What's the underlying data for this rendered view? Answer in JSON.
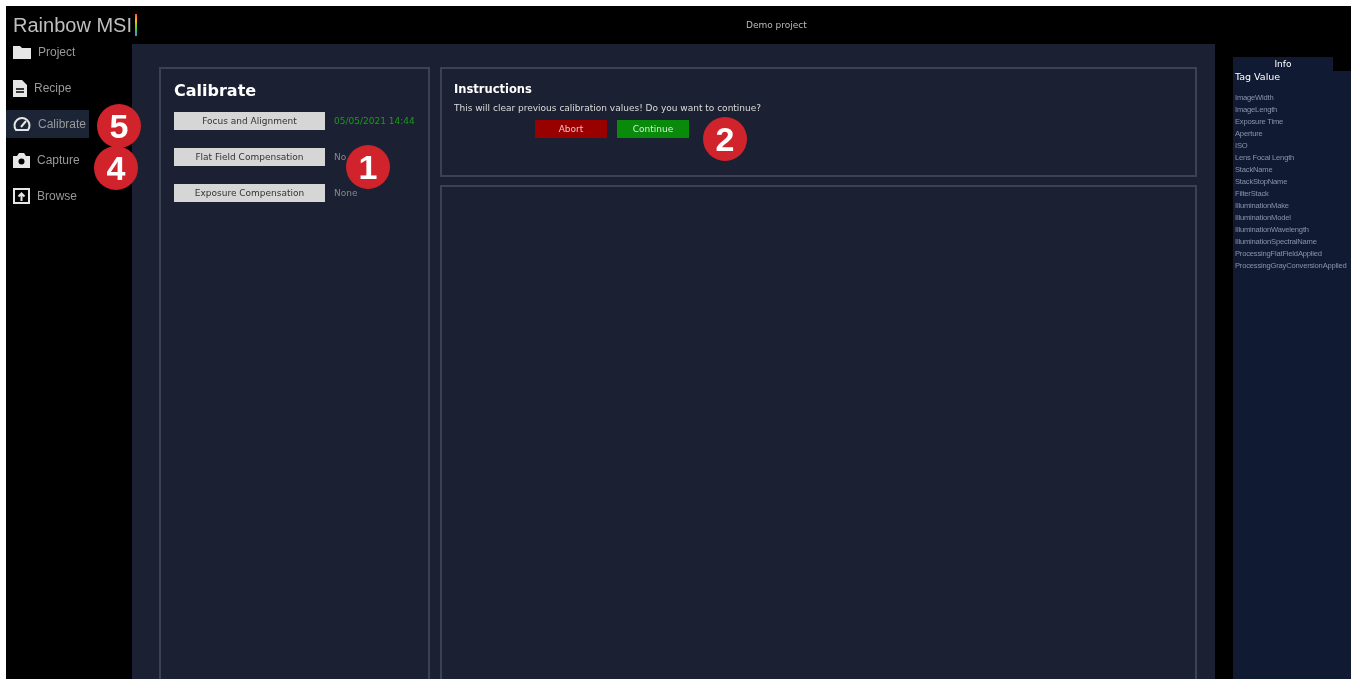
{
  "app_title": "Rainbow MSI",
  "project_title": "Demo project",
  "sidebar": {
    "items": [
      {
        "label": "Project",
        "selected": false
      },
      {
        "label": "Recipe",
        "selected": false
      },
      {
        "label": "Calibrate",
        "selected": true
      },
      {
        "label": "Capture",
        "selected": false
      },
      {
        "label": "Browse",
        "selected": false
      }
    ]
  },
  "calibrate": {
    "title": "Calibrate",
    "steps": [
      {
        "button": "Focus and Alignment",
        "status": "05/05/2021 14:44",
        "done": true
      },
      {
        "button": "Flat Field Compensation",
        "status": "No",
        "done": false
      },
      {
        "button": "Exposure Compensation",
        "status": "None",
        "done": false
      }
    ]
  },
  "instructions": {
    "title": "Instructions",
    "message": "This will clear previous calibration values! Do you want to continue?",
    "buttons": [
      {
        "label": "Abort",
        "kind": "abort"
      },
      {
        "label": "Continue",
        "kind": "continue"
      }
    ]
  },
  "info": {
    "tab": "Info",
    "header": "Tag Value",
    "tags": [
      "ImageWidth",
      "ImageLength",
      "Exposure Time",
      "Aperture",
      "ISO",
      "Lens Focal Length",
      "StackName",
      "StackStopName",
      "FilterStack",
      "IlluminationMake",
      "IlluminationModel",
      "IlluminationWavelength",
      "IlluminationSpectralName",
      "ProcessingFlatFieldApplied",
      "ProcessingGrayConversionApplied"
    ]
  },
  "callouts": [
    {
      "number": "5"
    },
    {
      "number": "4"
    },
    {
      "number": "1"
    },
    {
      "number": "2"
    }
  ]
}
